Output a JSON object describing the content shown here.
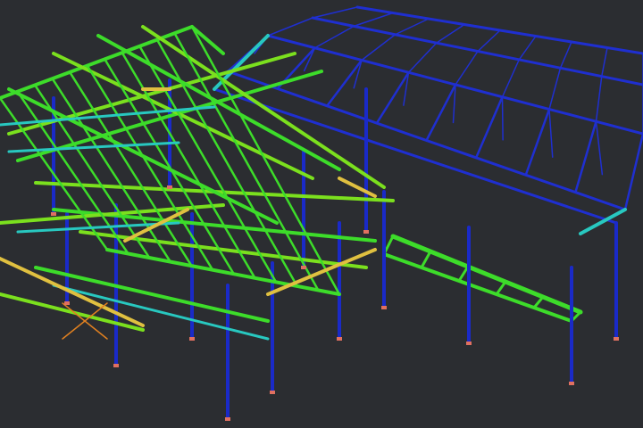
{
  "viewport": {
    "background": "#2b2d31",
    "colors": {
      "truss_blue": "#1f2fd0",
      "column_blue": "#1a2ac8",
      "beam_green": "#3ddc2a",
      "beam_lime": "#7be01e",
      "joist_cyan": "#28c8c0",
      "brace_yellow": "#e0c040",
      "base_plate": "#e07060",
      "brace_orange": "#e08020"
    }
  }
}
